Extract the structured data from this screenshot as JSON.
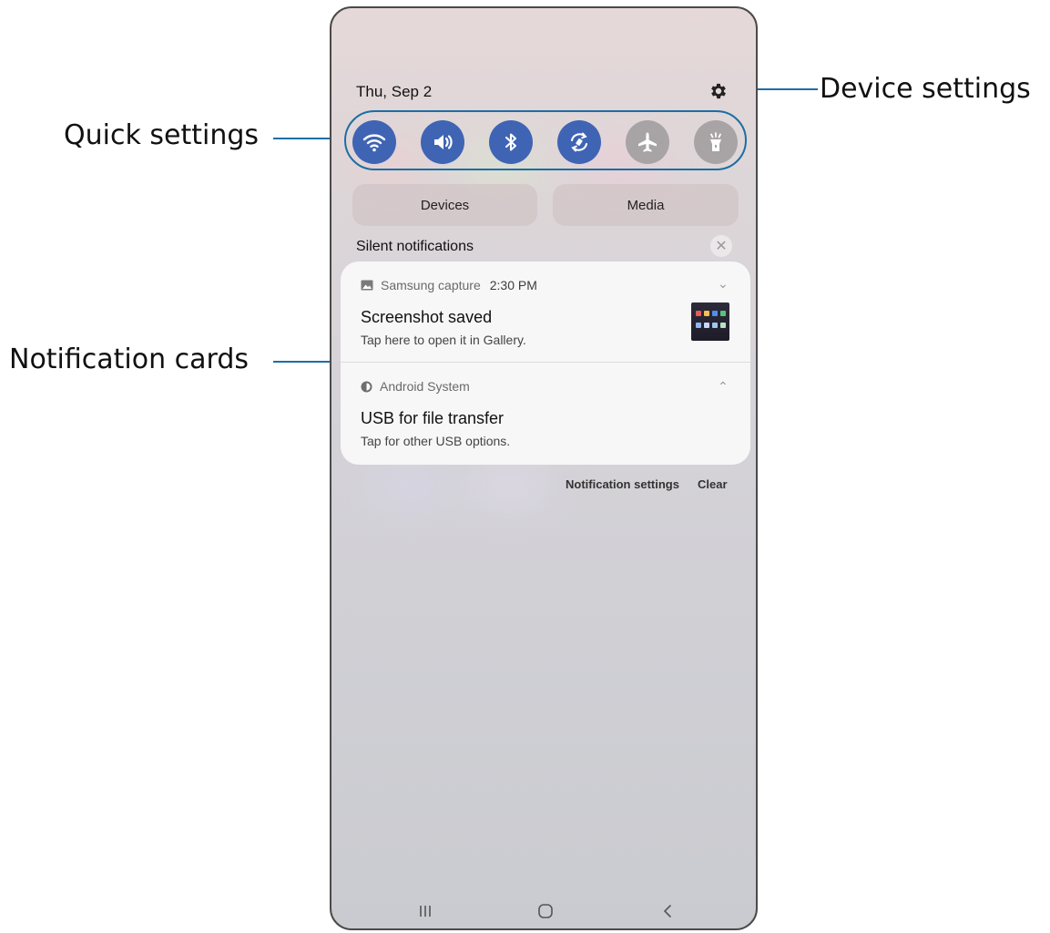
{
  "callouts": {
    "quick_settings": "Quick settings",
    "device_settings": "Device settings",
    "notification_cards": "Notification cards"
  },
  "header": {
    "date": "Thu, Sep 2",
    "settings_icon": "gear-icon"
  },
  "quick_settings": [
    {
      "name": "wifi",
      "icon": "wifi-icon",
      "state": "on"
    },
    {
      "name": "sound",
      "icon": "volume-icon",
      "state": "on"
    },
    {
      "name": "bluetooth",
      "icon": "bluetooth-icon",
      "state": "on"
    },
    {
      "name": "auto-rotate",
      "icon": "rotate-icon",
      "state": "on"
    },
    {
      "name": "airplane-mode",
      "icon": "airplane-icon",
      "state": "off"
    },
    {
      "name": "flashlight",
      "icon": "flashlight-icon",
      "state": "off"
    }
  ],
  "panels": {
    "devices_label": "Devices",
    "media_label": "Media"
  },
  "silent": {
    "label": "Silent notifications"
  },
  "notifications": [
    {
      "app": "Samsung capture",
      "time": "2:30 PM",
      "title": "Screenshot saved",
      "text": "Tap here to open it in Gallery.",
      "app_icon": "gallery-icon",
      "expand_icon": "chevron-down-icon"
    },
    {
      "app": "Android System",
      "title": "USB for file transfer",
      "text": "Tap for other USB options.",
      "app_icon": "android-system-icon",
      "expand_icon": "chevron-up-icon"
    }
  ],
  "footer": {
    "notification_settings": "Notification settings",
    "clear": "Clear"
  },
  "nav": {
    "recents": "recents-icon",
    "home": "home-icon",
    "back": "back-icon"
  },
  "colors": {
    "accent": "#1c6ea4",
    "toggle_on": "#3f64b4",
    "toggle_off": "#a8a4a6"
  }
}
